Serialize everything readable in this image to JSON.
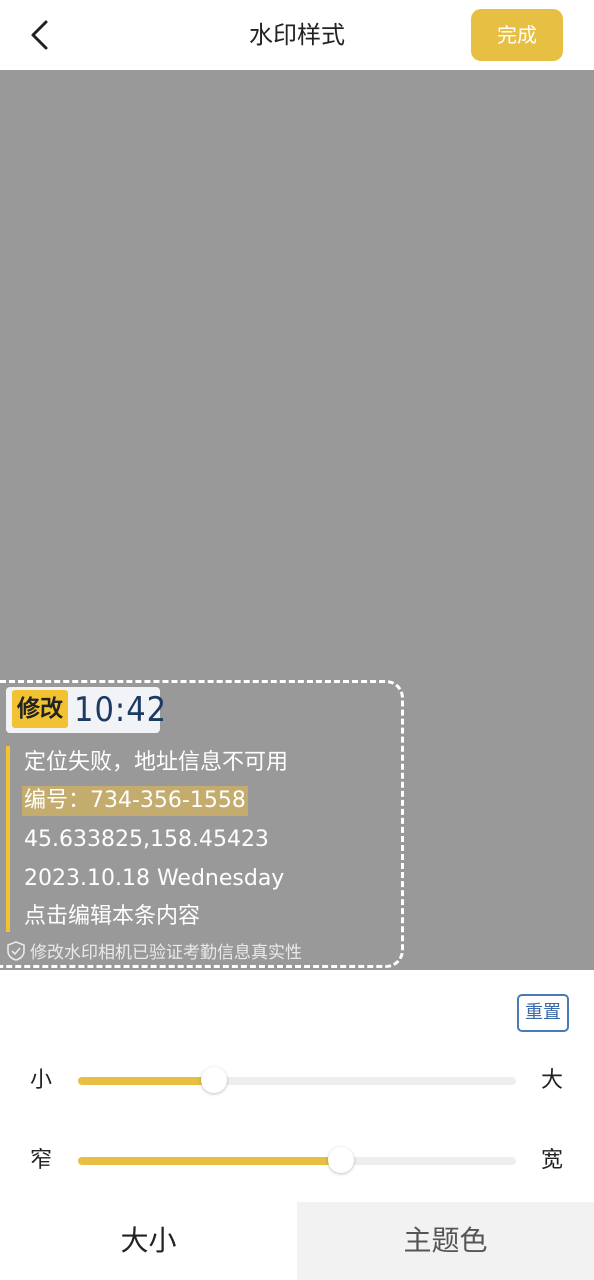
{
  "header": {
    "title": "水印样式",
    "done_label": "完成"
  },
  "watermark": {
    "tag": "修改",
    "time": "10:42",
    "lines": [
      "定位失败，地址信息不可用",
      "编号：734-356-1558",
      "45.633825,158.45423",
      "2023.10.18 Wednesday",
      "点击编辑本条内容"
    ],
    "verify_text": "修改水印相机已验证考勤信息真实性"
  },
  "controls": {
    "reset_label": "重置",
    "size": {
      "min_label": "小",
      "max_label": "大",
      "value_percent": 31
    },
    "width": {
      "min_label": "窄",
      "max_label": "宽",
      "value_percent": 60
    }
  },
  "tabs": [
    {
      "label": "大小",
      "active": true
    },
    {
      "label": "主题色",
      "active": false
    }
  ],
  "colors": {
    "accent": "#e7bf43",
    "preview_bg": "#999999"
  }
}
